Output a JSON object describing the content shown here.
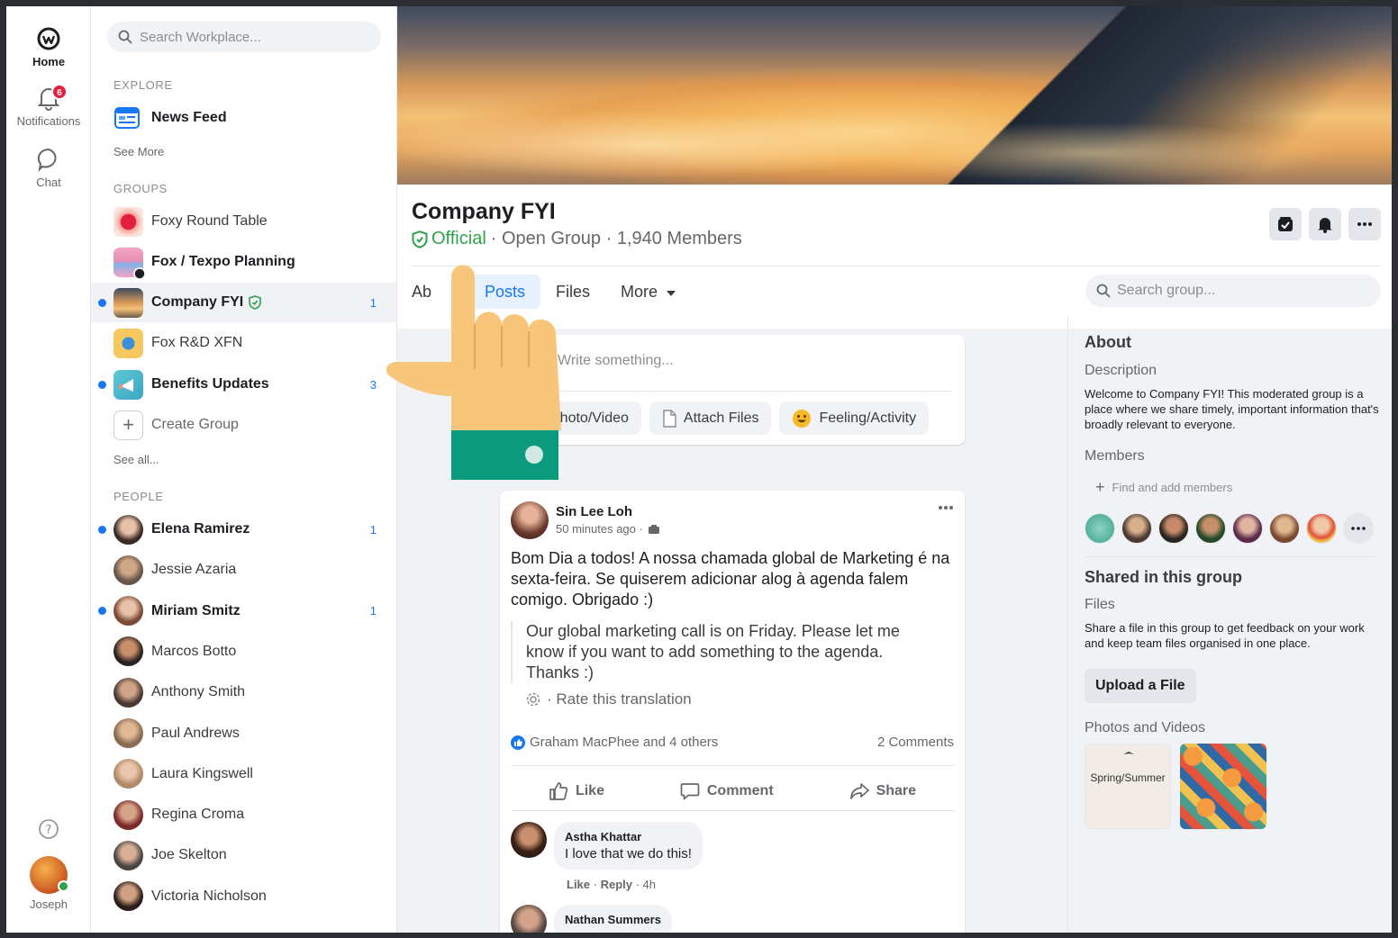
{
  "rail": {
    "home_label": "Home",
    "notifications_label": "Notifications",
    "notifications_badge": "6",
    "chat_label": "Chat",
    "user_label": "Joseph"
  },
  "sidebar": {
    "search_placeholder": "Search Workplace...",
    "explore_label": "EXPLORE",
    "news_feed_label": "News Feed",
    "see_more_label": "See More",
    "groups_label": "GROUPS",
    "groups": [
      {
        "name": "Foxy Round Table",
        "count": "",
        "unread": false
      },
      {
        "name": "Fox / Texpo Planning",
        "count": "",
        "unread": false
      },
      {
        "name": "Company FYI",
        "count": "1",
        "unread": true
      },
      {
        "name": "Fox R&D XFN",
        "count": "",
        "unread": false
      },
      {
        "name": "Benefits Updates",
        "count": "3",
        "unread": true
      }
    ],
    "create_group_label": "Create Group",
    "see_all_label": "See all...",
    "people_label": "PEOPLE",
    "people": [
      {
        "name": "Elena Ramirez",
        "count": "1",
        "unread": true
      },
      {
        "name": "Jessie Azaria",
        "count": "",
        "unread": false
      },
      {
        "name": "Miriam Smitz",
        "count": "1",
        "unread": true
      },
      {
        "name": "Marcos Botto",
        "count": "",
        "unread": false
      },
      {
        "name": "Anthony Smith",
        "count": "",
        "unread": false
      },
      {
        "name": "Paul Andrews",
        "count": "",
        "unread": false
      },
      {
        "name": "Laura Kingswell",
        "count": "",
        "unread": false
      },
      {
        "name": "Regina Croma",
        "count": "",
        "unread": false
      },
      {
        "name": "Joe Skelton",
        "count": "",
        "unread": false
      },
      {
        "name": "Victoria Nicholson",
        "count": "",
        "unread": false
      }
    ]
  },
  "group": {
    "title": "Company FYI",
    "official_label": "Official",
    "subtitle": "· Open Group · 1,940 Members",
    "tabs": {
      "about_partial": "Ab",
      "posts": "Posts",
      "files": "Files",
      "more": "More"
    },
    "search_placeholder": "Search group..."
  },
  "composer": {
    "placeholder": "Write something...",
    "photo_video": "Photo/Video",
    "attach_files": "Attach Files",
    "feeling_activity": "Feeling/Activity"
  },
  "post": {
    "author": "Sin Lee Loh",
    "time": "50 minutes ago ·",
    "text": "Bom Dia a todos! A nossa chamada global de Marketing é na sexta-feira. Se quiserem adicionar alog à agenda falem comigo. Obrigado :)",
    "translation": "Our global marketing call is on Friday. Please let me know if you want to add something to the agenda. Thanks :)",
    "rate_translation": "· Rate this translation",
    "likes_text": "Graham MacPhee and 4 others",
    "comments_count": "2 Comments",
    "like_label": "Like",
    "comment_label": "Comment",
    "share_label": "Share",
    "comments": [
      {
        "author": "Astha Khattar",
        "text": "I love that we do this!",
        "meta_like": "Like",
        "meta_reply": "Reply",
        "meta_time": "· 4h"
      },
      {
        "author": "Nathan Summers",
        "text": ""
      }
    ]
  },
  "about": {
    "heading": "About",
    "description_label": "Description",
    "description": "Welcome to Company FYI! This moderated group is a place where we share timely, important information that's broadly relevant to everyone.",
    "members_label": "Members",
    "find_members_placeholder": "Find and add members",
    "shared_heading": "Shared in this group",
    "files_label": "Files",
    "files_text": "Share a file in this group to get feedback on your work and keep team files organised in one place.",
    "upload_button": "Upload a  File",
    "photos_label": "Photos and Videos",
    "thumb1_label": "Spring/Summer"
  },
  "colors": {
    "accent": "#1877f2",
    "official_green": "#31a24c",
    "badge_red": "#e41e3f",
    "hand_skin": "#f7c67a",
    "hand_cuff": "#0a9a7e"
  }
}
